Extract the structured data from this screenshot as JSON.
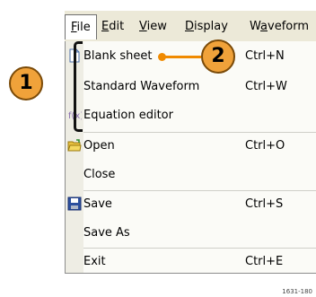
{
  "menubar": {
    "items": [
      {
        "label": "File",
        "accel": "F",
        "rest": "ile"
      },
      {
        "label": "Edit",
        "accel": "E",
        "rest": "dit"
      },
      {
        "label": "View",
        "accel": "V",
        "rest": "iew"
      },
      {
        "label": "Display",
        "accel": "D",
        "rest": "isplay"
      },
      {
        "label": "Waveform",
        "pre": "W",
        "accel": "a",
        "rest": "veform"
      }
    ]
  },
  "file_menu": {
    "items": [
      {
        "label": "Blank sheet",
        "shortcut": "Ctrl+N",
        "icon": "blank-sheet-icon"
      },
      {
        "label": "Standard Waveform",
        "shortcut": "Ctrl+W",
        "icon": ""
      },
      {
        "label": "Equation editor",
        "shortcut": "",
        "icon": "equation-icon"
      },
      {
        "label": "Open",
        "shortcut": "Ctrl+O",
        "icon": "open-folder-icon"
      },
      {
        "label": "Close",
        "shortcut": "",
        "icon": ""
      },
      {
        "label": "Save",
        "shortcut": "Ctrl+S",
        "icon": "floppy-disk-icon"
      },
      {
        "label": "Save As",
        "shortcut": "",
        "icon": ""
      },
      {
        "label": "Exit",
        "shortcut": "Ctrl+E",
        "icon": ""
      }
    ]
  },
  "callouts": {
    "one": "1",
    "two": "2"
  },
  "figure_id": "1631-180",
  "colors": {
    "callout_fill": "#f0a23a",
    "leader": "#f08a00",
    "menubar_bg": "#ece9d8"
  }
}
